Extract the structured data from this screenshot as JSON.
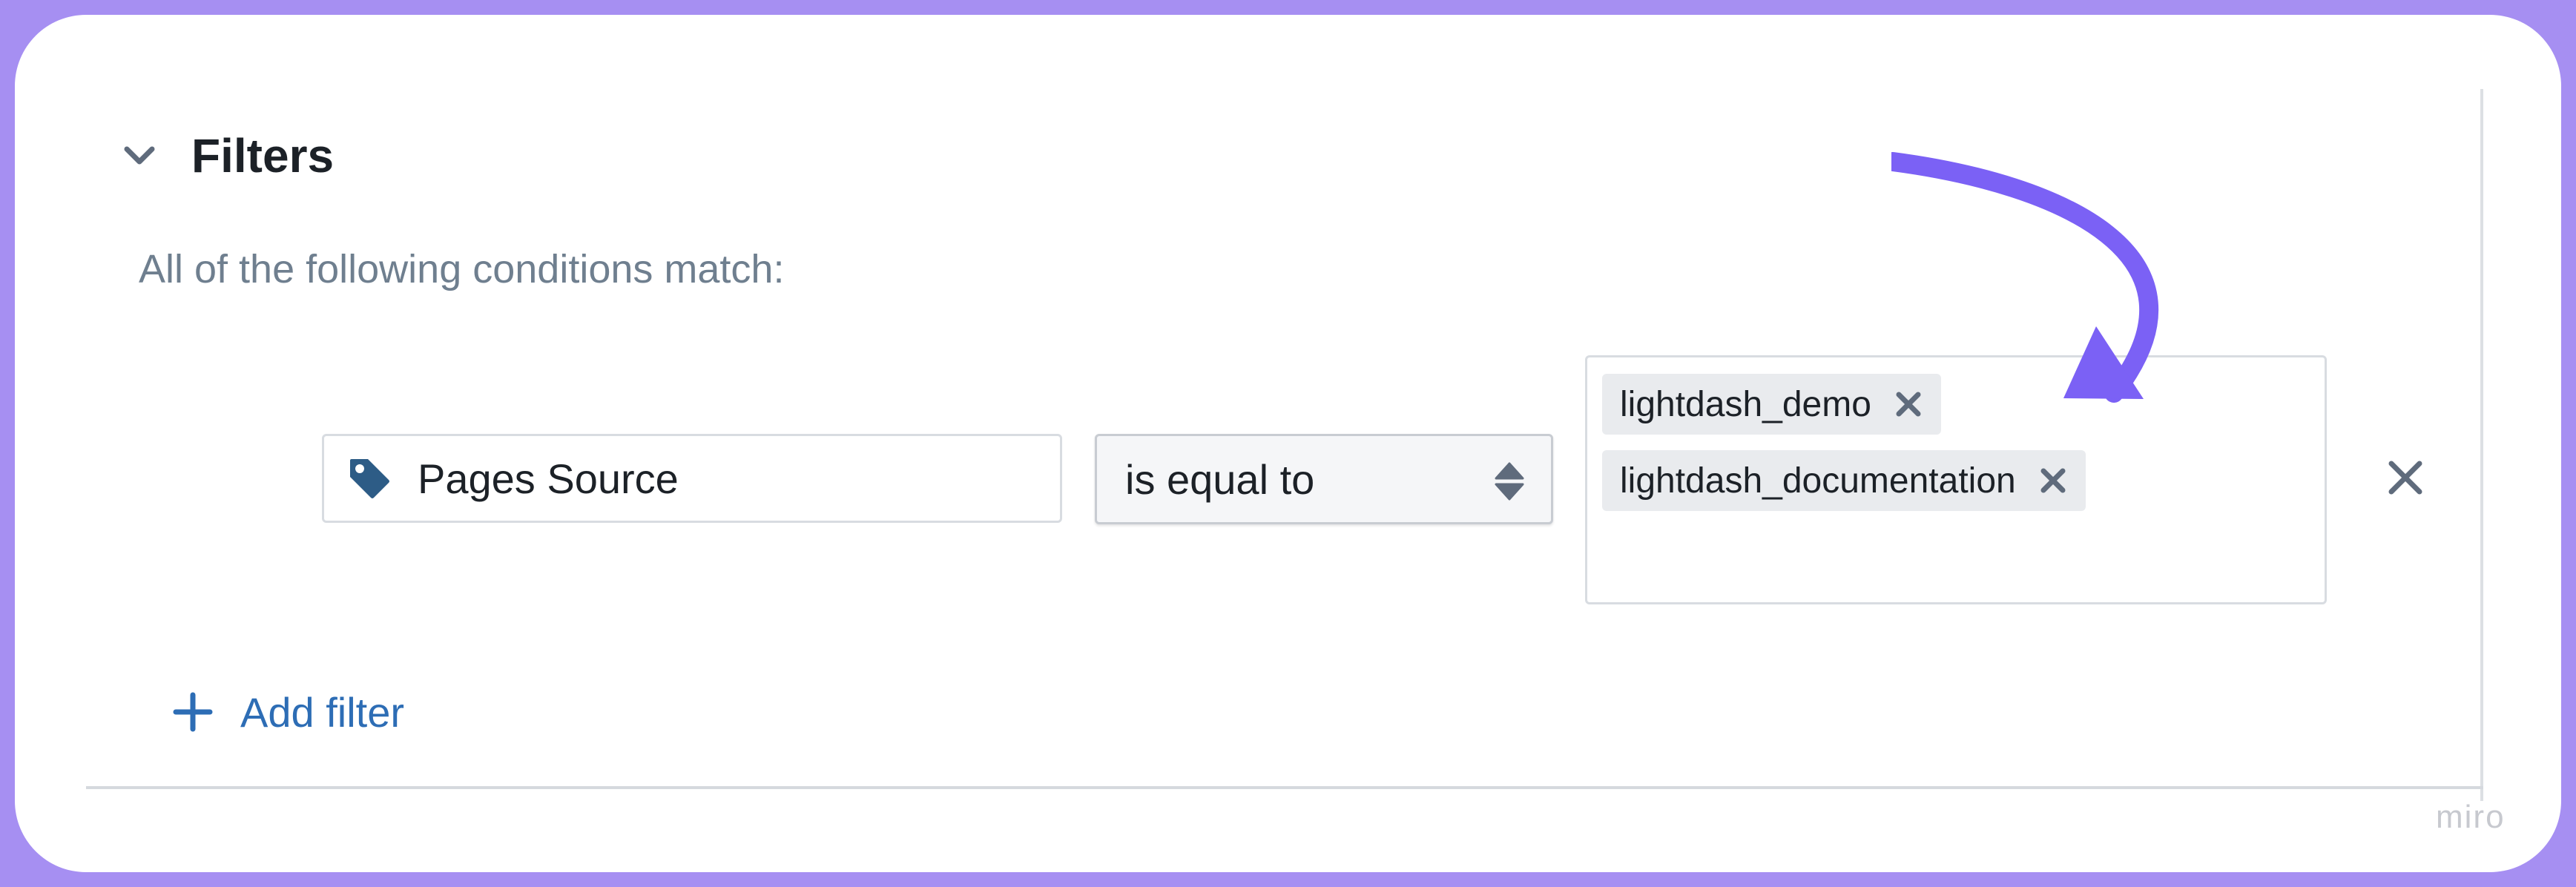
{
  "filters": {
    "title": "Filters",
    "subtitle": "All of the following conditions match:",
    "rule": {
      "field": "Pages Source",
      "operator": "is equal to",
      "values": [
        "lightdash_demo",
        "lightdash_documentation"
      ]
    },
    "add_filter_label": "Add filter"
  },
  "icons": {
    "collapse": "chevron-down-icon",
    "field": "tag-icon",
    "operator": "sort-icon",
    "tag_remove": "close-icon",
    "rule_remove": "close-icon",
    "add": "plus-icon"
  },
  "colors": {
    "background": "#a68ff2",
    "annotation_arrow": "#7b61f5",
    "link": "#2d6db5",
    "tag_icon": "#2d5c86"
  },
  "watermark": "miro"
}
